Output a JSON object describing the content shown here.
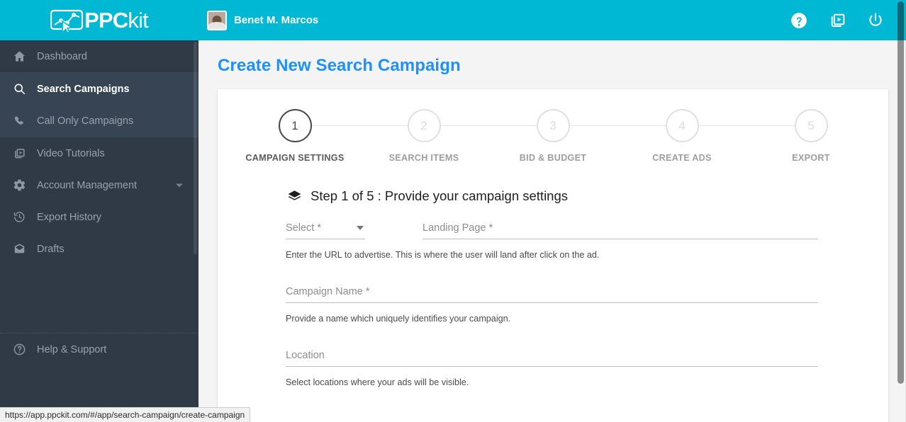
{
  "brand": {
    "name_bold": "PPC",
    "name_light": "kit",
    "logo_icon": "chart-cursor-icon",
    "teal": "#00b8d4",
    "sidebar_bg": "#2f3a46",
    "title_blue": "#1e90ff"
  },
  "topbar": {
    "user_name": "Benet M. Marcos",
    "avatar_alt": "user-avatar",
    "actions": [
      {
        "icon": "help-circle-icon",
        "label": "Help"
      },
      {
        "icon": "video-library-icon",
        "label": "Video Tutorials"
      },
      {
        "icon": "power-icon",
        "label": "Logout"
      }
    ]
  },
  "sidebar": {
    "groups": [
      {
        "active": false,
        "items": [
          {
            "label": "Dashboard",
            "icon": "home-icon",
            "active": false,
            "caret": false
          }
        ]
      },
      {
        "active": true,
        "items": [
          {
            "label": "Search Campaigns",
            "icon": "search-icon",
            "active": true,
            "caret": false
          },
          {
            "label": "Call Only Campaigns",
            "icon": "phone-icon",
            "active": false,
            "caret": false
          }
        ]
      },
      {
        "active": false,
        "items": [
          {
            "label": "Video Tutorials",
            "icon": "video-library-icon",
            "active": false,
            "caret": false
          },
          {
            "label": "Account Management",
            "icon": "gear-icon",
            "active": false,
            "caret": true
          },
          {
            "label": "Export History",
            "icon": "history-icon",
            "active": false,
            "caret": false
          },
          {
            "label": "Drafts",
            "icon": "mail-icon",
            "active": false,
            "caret": false
          }
        ]
      }
    ],
    "footer_item": {
      "label": "Help & Support",
      "icon": "help-circle-icon"
    }
  },
  "main": {
    "page_title": "Create New Search Campaign",
    "stepper": [
      {
        "number": "1",
        "label": "CAMPAIGN SETTINGS",
        "active": true
      },
      {
        "number": "2",
        "label": "SEARCH ITEMS",
        "active": false
      },
      {
        "number": "3",
        "label": "BID & BUDGET",
        "active": false
      },
      {
        "number": "4",
        "label": "CREATE ADS",
        "active": false
      },
      {
        "number": "5",
        "label": "EXPORT",
        "active": false
      }
    ],
    "step_heading": {
      "icon": "layers-icon",
      "text": "Step 1 of 5 : Provide your campaign settings"
    },
    "form": {
      "select_field": {
        "label": "Select *",
        "value": "",
        "caret_icon": "chevron-down-icon"
      },
      "landing_page": {
        "label": "Landing Page *",
        "value": ""
      },
      "landing_hint": "Enter the URL to advertise. This is where the user will land after click on the ad.",
      "campaign_name": {
        "label": "Campaign Name *",
        "value": ""
      },
      "campaign_hint": "Provide a name which uniquely identifies your campaign.",
      "location": {
        "label": "Location",
        "value": ""
      },
      "location_hint": "Select locations where your ads will be visible."
    }
  },
  "statusbar": {
    "url": "https://app.ppckit.com/#/app/search-campaign/create-campaign"
  }
}
